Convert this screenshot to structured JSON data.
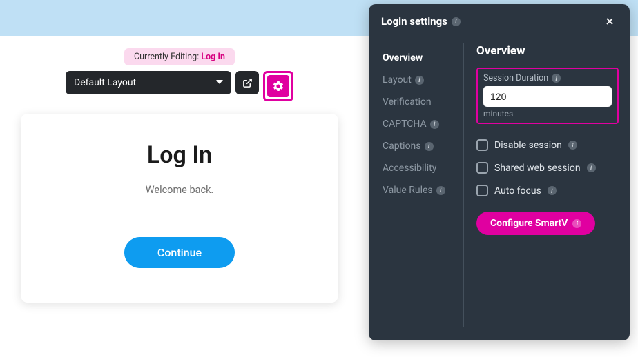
{
  "banner": {},
  "editing": {
    "prefix": "Currently Editing: ",
    "screen": "Log In"
  },
  "layoutBar": {
    "selected": "Default Layout"
  },
  "loginCard": {
    "title": "Log In",
    "subtitle": "Welcome back.",
    "continue": "Continue"
  },
  "panel": {
    "title": "Login settings",
    "nav": {
      "overview": "Overview",
      "layout": "Layout",
      "verification": "Verification",
      "captcha": "CAPTCHA",
      "captions": "Captions",
      "accessibility": "Accessibility",
      "valueRules": "Value Rules"
    },
    "content": {
      "heading": "Overview",
      "sessionDuration": {
        "label": "Session Duration",
        "value": "120",
        "unit": "minutes"
      },
      "disableSession": "Disable session",
      "sharedSession": "Shared web session",
      "autoFocus": "Auto focus",
      "configure": "Configure SmartV"
    }
  }
}
